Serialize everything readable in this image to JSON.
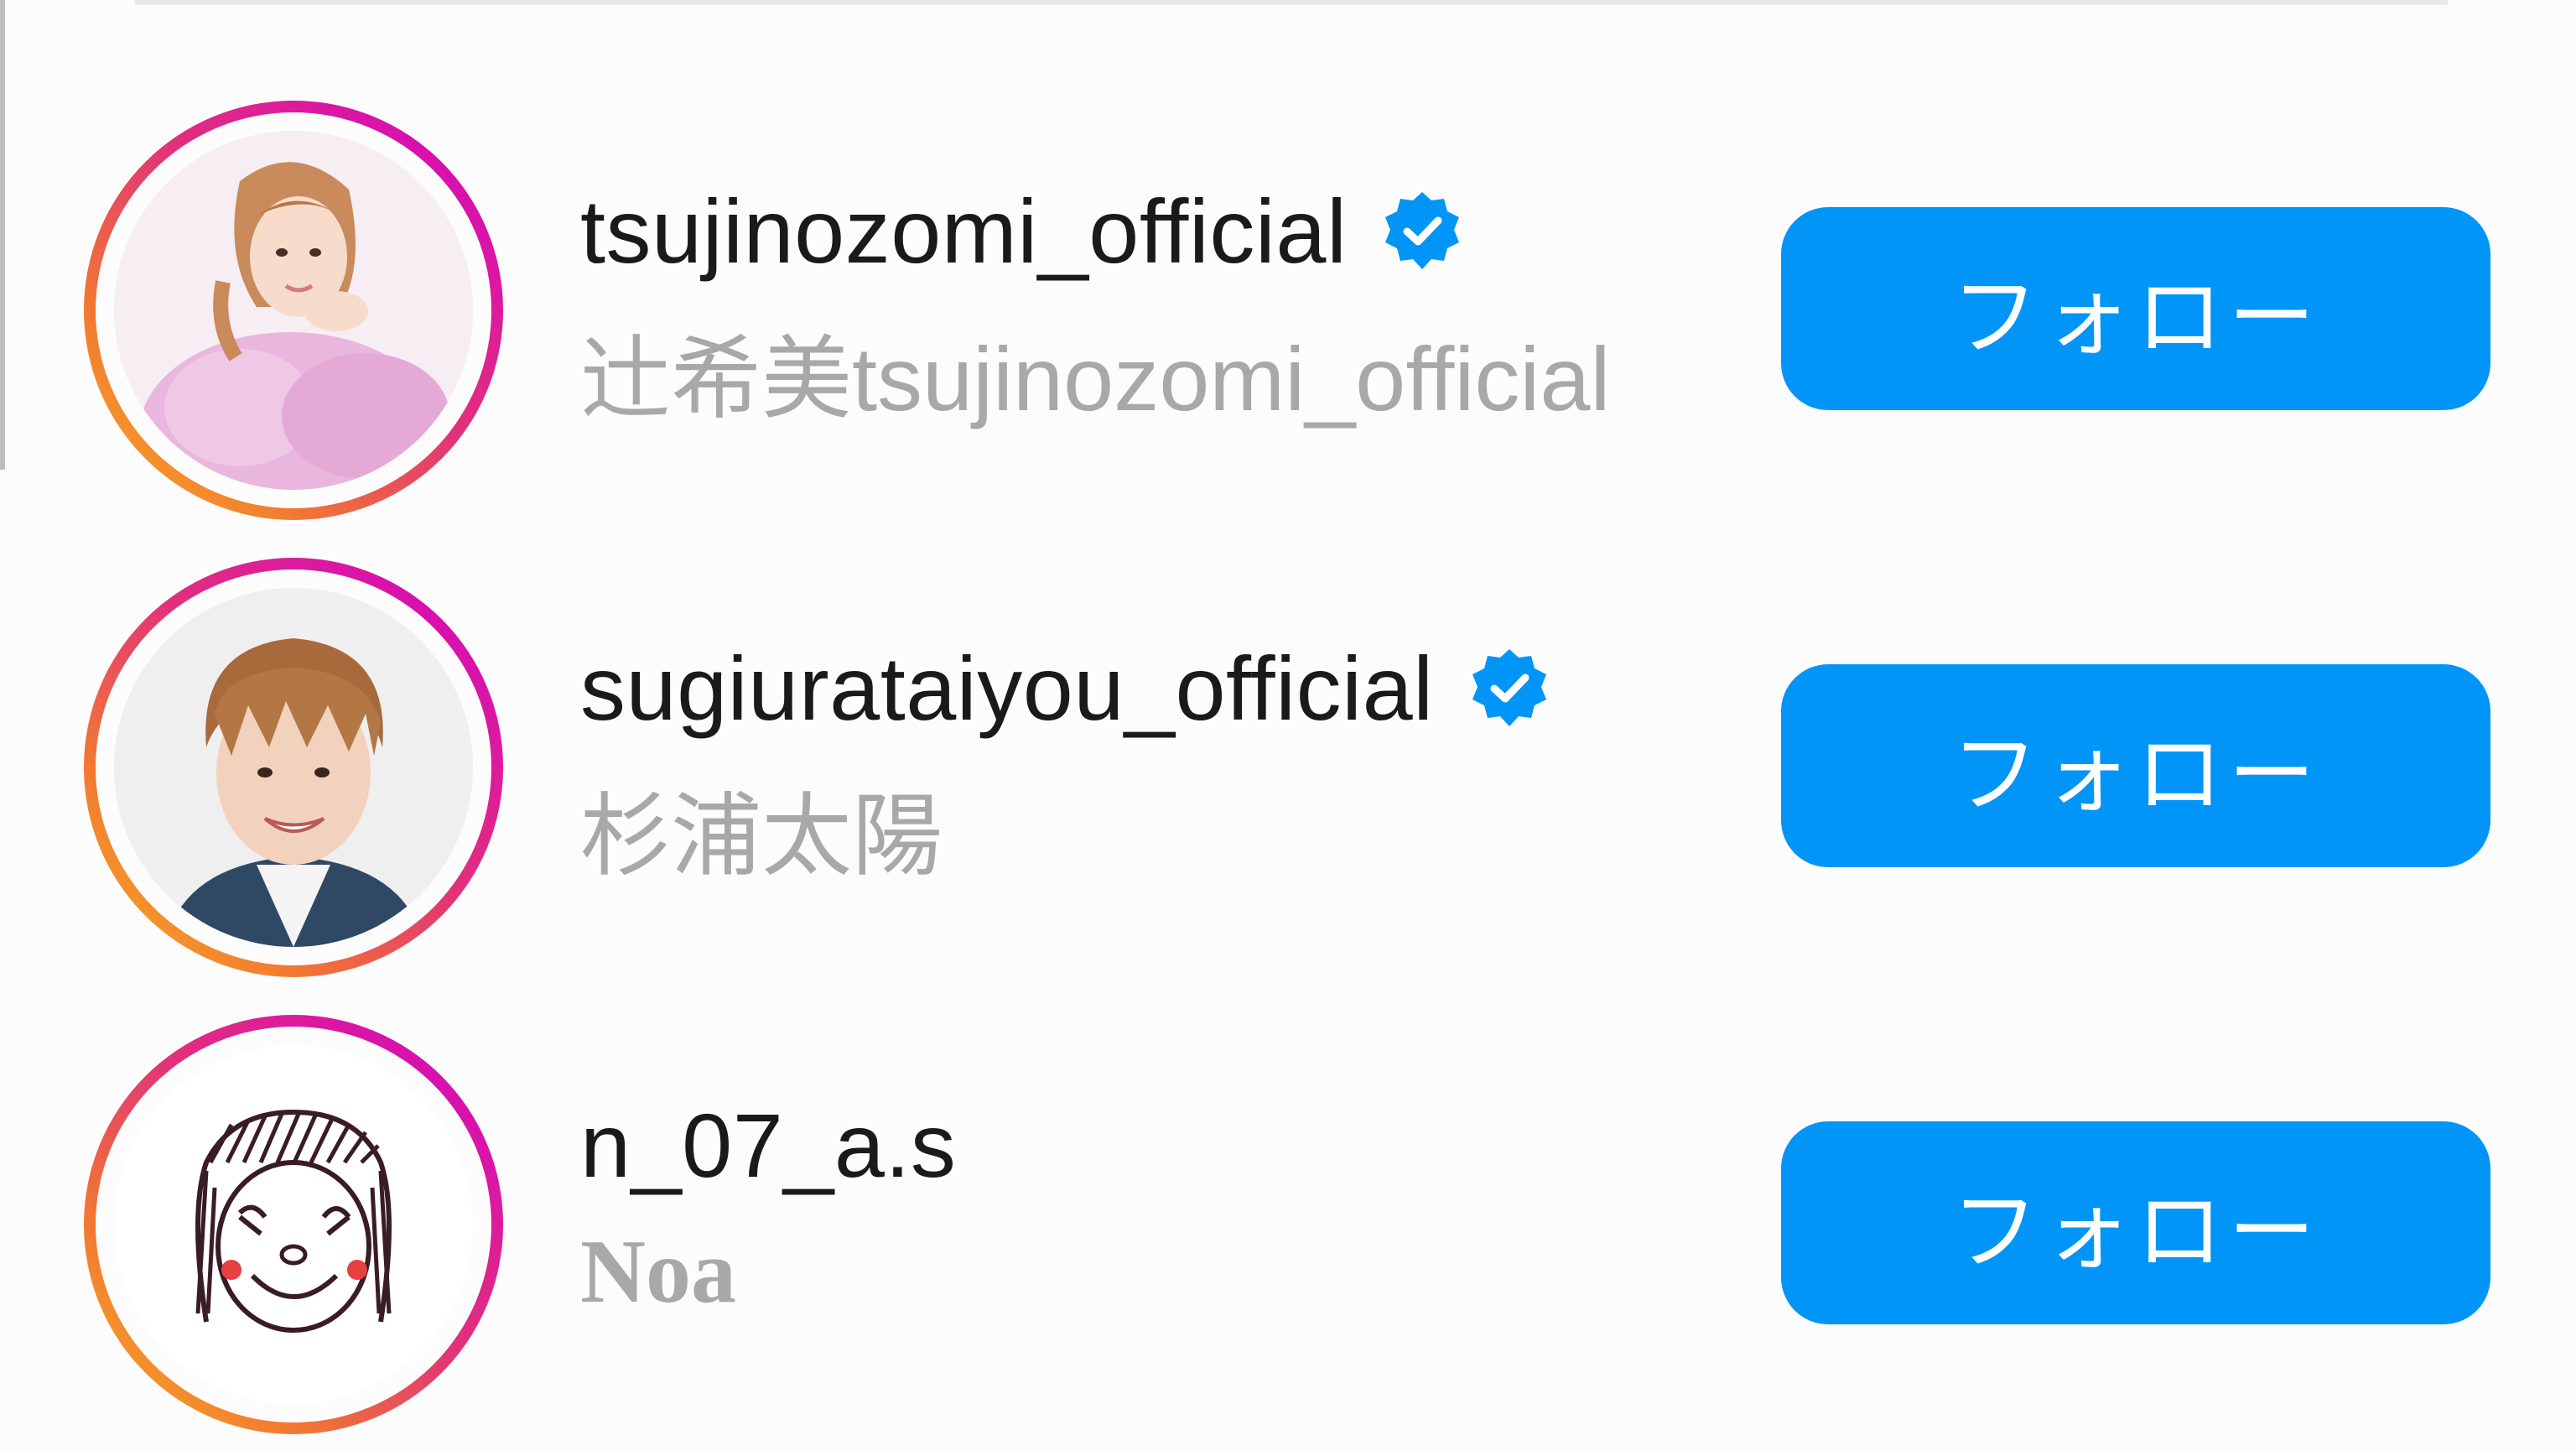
{
  "accent_color": "#0095f6",
  "verified_color": "#0095f6",
  "story_ring_colors": [
    "#d400c8",
    "#e2307a",
    "#f27a30",
    "#f8b324"
  ],
  "accounts": [
    {
      "username": "tsujinozomi_official",
      "full_name": "辻希美tsujinozomi_official",
      "verified": true,
      "avatar_icon": "profile-photo",
      "follow_label": "フォロー"
    },
    {
      "username": "sugiurataiyou_official",
      "full_name": "杉浦太陽",
      "verified": true,
      "avatar_icon": "profile-photo",
      "follow_label": "フォロー"
    },
    {
      "username": "n_07_a.s",
      "full_name": "Noa",
      "verified": false,
      "avatar_icon": "drawing-avatar",
      "follow_label": "フォロー"
    }
  ]
}
